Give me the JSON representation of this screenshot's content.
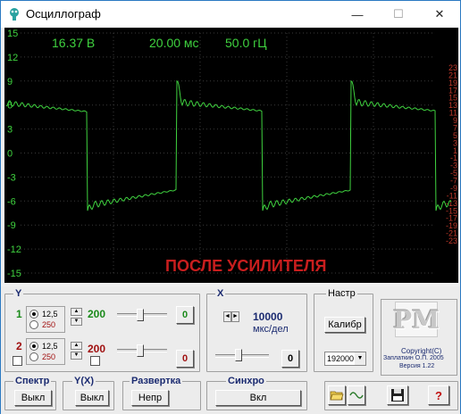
{
  "window": {
    "title": "Осциллограф",
    "min_glyph": "—",
    "max_glyph": "☐",
    "close_glyph": "✕"
  },
  "scope": {
    "readout_voltage": "16.37 В",
    "readout_time": "20.00 мс",
    "readout_freq": "50.0 гЦ",
    "caption": "ПОСЛЕ УСИЛИТЕЛЯ",
    "left_ticks": [
      "15",
      "12",
      "9",
      "6",
      "3",
      "0",
      "-3",
      "-6",
      "-9",
      "-12",
      "-15"
    ],
    "right_ticks": [
      "23",
      "21",
      "19",
      "17",
      "15",
      "13",
      "11",
      "9",
      "7",
      "5",
      "3",
      "1",
      "-1",
      "-3",
      "-5",
      "-7",
      "-9",
      "-11",
      "-13",
      "-15",
      "-17",
      "-19",
      "-21",
      "-23"
    ],
    "colors": {
      "trace": "#3fd23f",
      "grid": "#3a3a3a",
      "left_axis": "#3fd23f",
      "right_axis": "#c0392b",
      "caption": "#c81e1e"
    }
  },
  "controls": {
    "y_group_label": "Y",
    "ch1": {
      "num": "1",
      "opt_a": "12,5",
      "opt_b": "250",
      "gain": "200",
      "offset": "0",
      "color": "#1a8a1a"
    },
    "ch2": {
      "num": "2",
      "opt_a": "12,5",
      "opt_b": "250",
      "gain": "200",
      "offset": "0",
      "color": "#a01010"
    },
    "x_group_label": "X",
    "x_value": "10000",
    "x_unit": "мкс/дел",
    "x_offset": "0",
    "settings_label": "Настр",
    "calib_button": "Калибр",
    "baud_select": "192000",
    "spectrum_label": "Спектр",
    "spectrum_button": "Выкл",
    "yx_label": "Y(X)",
    "yx_button": "Выкл",
    "sweep_label": "Развертка",
    "sweep_button": "Непр",
    "sync_label": "Синхро",
    "sync_button": "Вкл",
    "logo_text": "PM",
    "copyright_line1": "Copyright(C)",
    "copyright_line2": "Заплаткин О.П. 2005",
    "copyright_line3": "Версия 1.22",
    "help_button": "?"
  }
}
